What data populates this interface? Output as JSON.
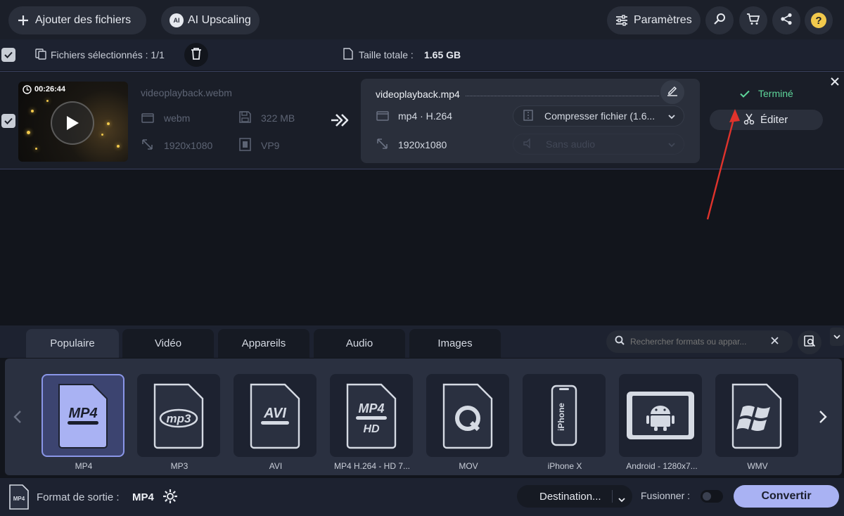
{
  "toolbar": {
    "add_files_label": "Ajouter des fichiers",
    "ai_upscaling_label": "AI Upscaling",
    "ai_badge": "AI",
    "settings_label": "Paramètres"
  },
  "selection": {
    "selected_label": "Fichiers sélectionnés : 1/1",
    "total_size_label": "Taille totale :",
    "total_size_value": "1.65 GB"
  },
  "file": {
    "duration": "00:26:44",
    "source_name": "videoplayback.webm",
    "source_format": "webm",
    "source_size": "322 MB",
    "source_resolution": "1920x1080",
    "source_codec": "VP9",
    "output_name": "videoplayback.mp4",
    "output_format": "mp4 · H.264",
    "output_resolution": "1920x1080",
    "compress_label": "Compresser fichier (1.6...",
    "audio_label": "Sans audio",
    "status": "Terminé",
    "edit_label": "Éditer"
  },
  "tabs": [
    "Populaire",
    "Vidéo",
    "Appareils",
    "Audio",
    "Images"
  ],
  "search": {
    "placeholder": "Rechercher formats ou appar..."
  },
  "formats": [
    {
      "label": "MP4",
      "icon": "mp4-icon"
    },
    {
      "label": "MP3",
      "icon": "mp3-icon"
    },
    {
      "label": "AVI",
      "icon": "avi-icon"
    },
    {
      "label": "MP4 H.264 - HD 7...",
      "icon": "mp4-hd-icon"
    },
    {
      "label": "MOV",
      "icon": "quicktime-icon"
    },
    {
      "label": "iPhone X",
      "icon": "iphone-icon"
    },
    {
      "label": "Android - 1280x7...",
      "icon": "android-icon"
    },
    {
      "label": "WMV",
      "icon": "windows-icon"
    }
  ],
  "footer": {
    "output_format_label": "Format de sortie :",
    "output_format_value": "MP4",
    "destination_label": "Destination...",
    "merge_label": "Fusionner :",
    "convert_label": "Convertir"
  },
  "colors": {
    "accent": "#a9b2f3",
    "success": "#5ed59a",
    "annotation_arrow": "#e0332c"
  }
}
